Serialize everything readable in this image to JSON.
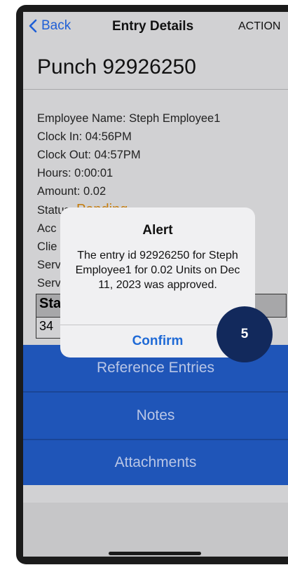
{
  "nav": {
    "back_label": "Back",
    "title": "Entry Details",
    "action_label": "ACTION"
  },
  "entry": {
    "title": "Punch 92926250",
    "employee_name": "Employee Name: Steph Employee1",
    "clock_in": "Clock In: 04:56PM",
    "clock_out": "Clock Out: 04:57PM",
    "hours": "Hours: 0:00:01",
    "amount": "Amount: 0.02",
    "status_label": "Status: ",
    "status_value": "Pending",
    "status_color": "#c47b0b",
    "partial_rows": [
      "Acc",
      "Clie",
      "Serv",
      "Serv"
    ]
  },
  "table": {
    "header_first": "Sta",
    "row_first": "34"
  },
  "buttons": {
    "reference_entries": "Reference Entries",
    "notes": "Notes",
    "attachments": "Attachments"
  },
  "alert": {
    "title": "Alert",
    "message": "The entry id 92926250 for Steph Employee1 for 0.02 Units on Dec 11, 2023 was approved.",
    "confirm_label": "Confirm"
  },
  "step_badge": "5",
  "colors": {
    "accent_blue": "#1f55b8",
    "link_blue": "#1f6ad6",
    "badge_navy": "#12295c"
  }
}
